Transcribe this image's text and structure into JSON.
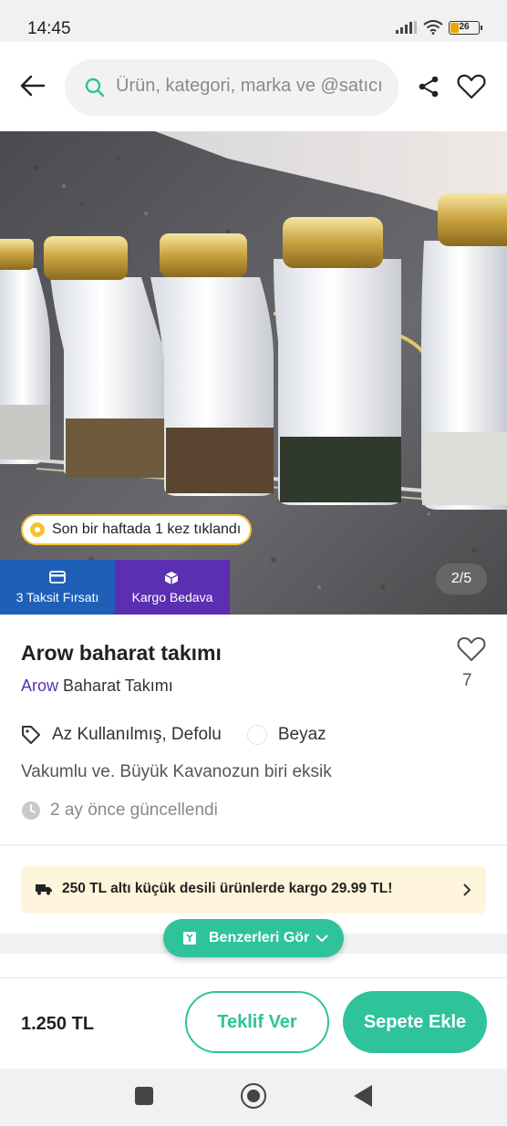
{
  "status_bar": {
    "time": "14:45",
    "battery": "26"
  },
  "search": {
    "placeholder": "Ürün, kategori, marka ve @satıcı"
  },
  "gallery": {
    "click_badge": "Son bir haftada 1 kez tıklandı",
    "taksit_label": "3 Taksit Fırsatı",
    "kargo_label": "Kargo Bedava",
    "counter": "2/5"
  },
  "product": {
    "title": "Arow baharat takımı",
    "brand": "Arow",
    "category": "Baharat Takımı",
    "like_count": "7",
    "condition": "Az Kullanılmış, Defolu",
    "color": "Beyaz",
    "description": "Vakumlu ve. Büyük Kavanozun biri eksik",
    "updated": "2 ay önce güncellendi"
  },
  "shipping": {
    "banner": "250 TL altı küçük desili ürünlerde kargo 29.99 TL!"
  },
  "similar": {
    "label": "Benzerleri Gör"
  },
  "bottom": {
    "price": "1.250 TL",
    "offer_label": "Teklif Ver",
    "cart_label": "Sepete Ekle"
  },
  "colors": {
    "accent": "#2ec39b",
    "brand_purple": "#5a2fb0",
    "taksit_blue": "#1f5fb8",
    "badge_yellow": "#f4c430"
  }
}
